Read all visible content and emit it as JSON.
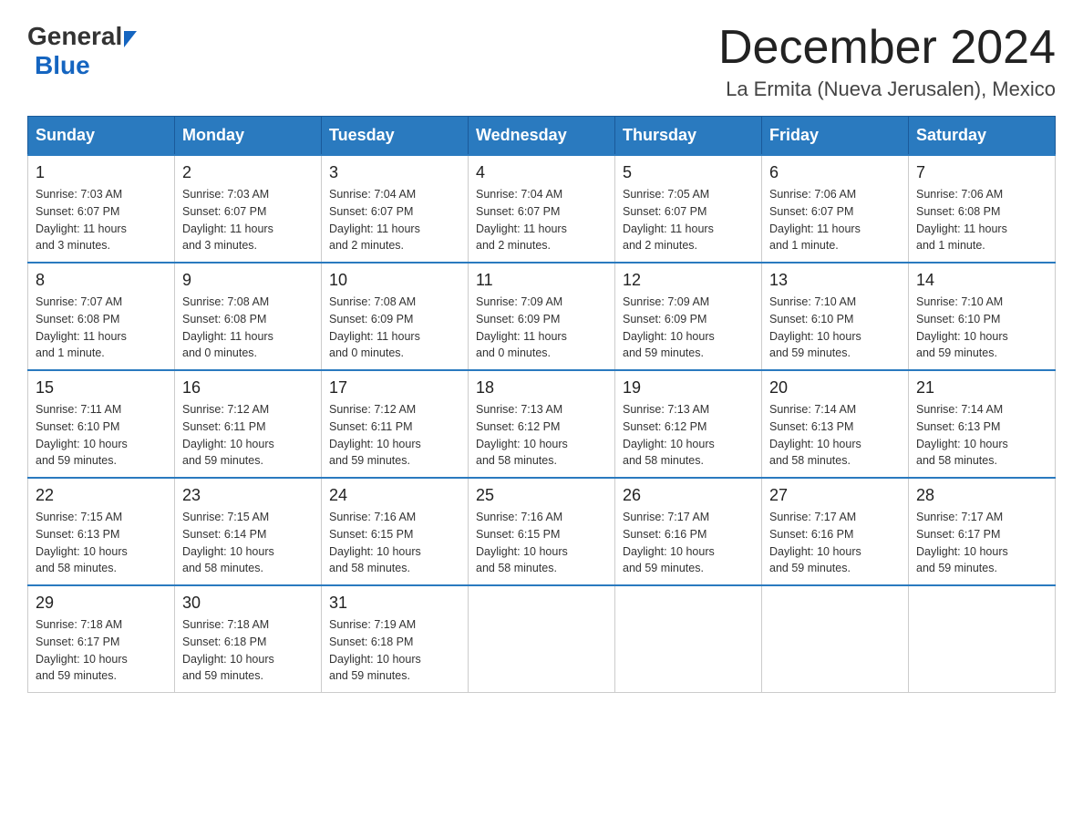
{
  "header": {
    "logo_general": "General",
    "logo_blue": "Blue",
    "month_title": "December 2024",
    "location": "La Ermita (Nueva Jerusalen), Mexico"
  },
  "weekdays": [
    "Sunday",
    "Monday",
    "Tuesday",
    "Wednesday",
    "Thursday",
    "Friday",
    "Saturday"
  ],
  "weeks": [
    [
      {
        "day": "1",
        "info": "Sunrise: 7:03 AM\nSunset: 6:07 PM\nDaylight: 11 hours\nand 3 minutes."
      },
      {
        "day": "2",
        "info": "Sunrise: 7:03 AM\nSunset: 6:07 PM\nDaylight: 11 hours\nand 3 minutes."
      },
      {
        "day": "3",
        "info": "Sunrise: 7:04 AM\nSunset: 6:07 PM\nDaylight: 11 hours\nand 2 minutes."
      },
      {
        "day": "4",
        "info": "Sunrise: 7:04 AM\nSunset: 6:07 PM\nDaylight: 11 hours\nand 2 minutes."
      },
      {
        "day": "5",
        "info": "Sunrise: 7:05 AM\nSunset: 6:07 PM\nDaylight: 11 hours\nand 2 minutes."
      },
      {
        "day": "6",
        "info": "Sunrise: 7:06 AM\nSunset: 6:07 PM\nDaylight: 11 hours\nand 1 minute."
      },
      {
        "day": "7",
        "info": "Sunrise: 7:06 AM\nSunset: 6:08 PM\nDaylight: 11 hours\nand 1 minute."
      }
    ],
    [
      {
        "day": "8",
        "info": "Sunrise: 7:07 AM\nSunset: 6:08 PM\nDaylight: 11 hours\nand 1 minute."
      },
      {
        "day": "9",
        "info": "Sunrise: 7:08 AM\nSunset: 6:08 PM\nDaylight: 11 hours\nand 0 minutes."
      },
      {
        "day": "10",
        "info": "Sunrise: 7:08 AM\nSunset: 6:09 PM\nDaylight: 11 hours\nand 0 minutes."
      },
      {
        "day": "11",
        "info": "Sunrise: 7:09 AM\nSunset: 6:09 PM\nDaylight: 11 hours\nand 0 minutes."
      },
      {
        "day": "12",
        "info": "Sunrise: 7:09 AM\nSunset: 6:09 PM\nDaylight: 10 hours\nand 59 minutes."
      },
      {
        "day": "13",
        "info": "Sunrise: 7:10 AM\nSunset: 6:10 PM\nDaylight: 10 hours\nand 59 minutes."
      },
      {
        "day": "14",
        "info": "Sunrise: 7:10 AM\nSunset: 6:10 PM\nDaylight: 10 hours\nand 59 minutes."
      }
    ],
    [
      {
        "day": "15",
        "info": "Sunrise: 7:11 AM\nSunset: 6:10 PM\nDaylight: 10 hours\nand 59 minutes."
      },
      {
        "day": "16",
        "info": "Sunrise: 7:12 AM\nSunset: 6:11 PM\nDaylight: 10 hours\nand 59 minutes."
      },
      {
        "day": "17",
        "info": "Sunrise: 7:12 AM\nSunset: 6:11 PM\nDaylight: 10 hours\nand 59 minutes."
      },
      {
        "day": "18",
        "info": "Sunrise: 7:13 AM\nSunset: 6:12 PM\nDaylight: 10 hours\nand 58 minutes."
      },
      {
        "day": "19",
        "info": "Sunrise: 7:13 AM\nSunset: 6:12 PM\nDaylight: 10 hours\nand 58 minutes."
      },
      {
        "day": "20",
        "info": "Sunrise: 7:14 AM\nSunset: 6:13 PM\nDaylight: 10 hours\nand 58 minutes."
      },
      {
        "day": "21",
        "info": "Sunrise: 7:14 AM\nSunset: 6:13 PM\nDaylight: 10 hours\nand 58 minutes."
      }
    ],
    [
      {
        "day": "22",
        "info": "Sunrise: 7:15 AM\nSunset: 6:13 PM\nDaylight: 10 hours\nand 58 minutes."
      },
      {
        "day": "23",
        "info": "Sunrise: 7:15 AM\nSunset: 6:14 PM\nDaylight: 10 hours\nand 58 minutes."
      },
      {
        "day": "24",
        "info": "Sunrise: 7:16 AM\nSunset: 6:15 PM\nDaylight: 10 hours\nand 58 minutes."
      },
      {
        "day": "25",
        "info": "Sunrise: 7:16 AM\nSunset: 6:15 PM\nDaylight: 10 hours\nand 58 minutes."
      },
      {
        "day": "26",
        "info": "Sunrise: 7:17 AM\nSunset: 6:16 PM\nDaylight: 10 hours\nand 59 minutes."
      },
      {
        "day": "27",
        "info": "Sunrise: 7:17 AM\nSunset: 6:16 PM\nDaylight: 10 hours\nand 59 minutes."
      },
      {
        "day": "28",
        "info": "Sunrise: 7:17 AM\nSunset: 6:17 PM\nDaylight: 10 hours\nand 59 minutes."
      }
    ],
    [
      {
        "day": "29",
        "info": "Sunrise: 7:18 AM\nSunset: 6:17 PM\nDaylight: 10 hours\nand 59 minutes."
      },
      {
        "day": "30",
        "info": "Sunrise: 7:18 AM\nSunset: 6:18 PM\nDaylight: 10 hours\nand 59 minutes."
      },
      {
        "day": "31",
        "info": "Sunrise: 7:19 AM\nSunset: 6:18 PM\nDaylight: 10 hours\nand 59 minutes."
      },
      null,
      null,
      null,
      null
    ]
  ]
}
